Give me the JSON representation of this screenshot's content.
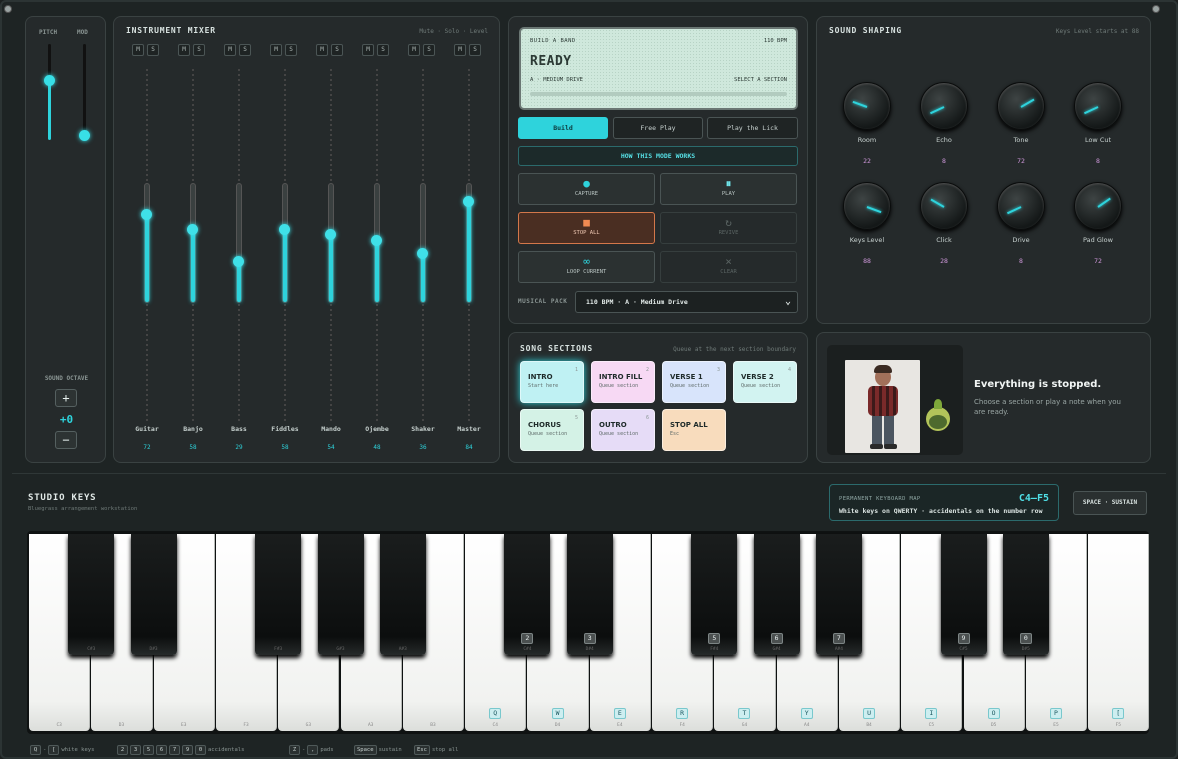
{
  "pitch_mod": {
    "pitch_label": "PITCH",
    "mod_label": "MOD",
    "pitch_level": 0.62,
    "mod_level": 0.05
  },
  "octave": {
    "label": "SOUND OCTAVE",
    "plus": "+",
    "value": "+0",
    "minus": "−"
  },
  "mixer": {
    "title": "INSTRUMENT MIXER",
    "subtitle": "Mute · Solo · Level",
    "mute_label": "M",
    "solo_label": "S",
    "channels": [
      {
        "name": "Guitar",
        "value": "72",
        "level": 72
      },
      {
        "name": "Banjo",
        "value": "58",
        "level": 58
      },
      {
        "name": "Bass",
        "value": "29",
        "level": 29
      },
      {
        "name": "Fiddles",
        "value": "58",
        "level": 58
      },
      {
        "name": "Mando",
        "value": "54",
        "level": 54
      },
      {
        "name": "Ojembe",
        "value": "48",
        "level": 48
      },
      {
        "name": "Shaker",
        "value": "36",
        "level": 36
      },
      {
        "name": "Master",
        "value": "84",
        "level": 84
      }
    ]
  },
  "display": {
    "mode_name": "BUILD A BAND",
    "bpm": "110 BPM",
    "status": "READY",
    "key": "A · MEDIUM DRIVE",
    "hint": "SELECT A SECTION"
  },
  "modes": {
    "build": "Build",
    "free_play": "Free Play",
    "play_lick": "Play the Lick"
  },
  "how_button": "HOW THIS MODE WORKS",
  "transport": {
    "capture": "CAPTURE",
    "play": "PLAY",
    "stop_all": "STOP ALL",
    "revive": "REVIVE",
    "loop_current": "LOOP CURRENT",
    "clear": "CLEAR"
  },
  "pack": {
    "label": "MUSICAL PACK",
    "value": "110 BPM · A · Medium Drive"
  },
  "shaping": {
    "title": "SOUND SHAPING",
    "subtitle": "Keys Level starts at 88",
    "knobs": [
      {
        "name": "Room",
        "value": "22",
        "angle": 200
      },
      {
        "name": "Echo",
        "value": "8",
        "angle": 155
      },
      {
        "name": "Tone",
        "value": "72",
        "angle": -30
      },
      {
        "name": "Low Cut",
        "value": "8",
        "angle": 155
      },
      {
        "name": "Keys Level",
        "value": "88",
        "angle": 20
      },
      {
        "name": "Click",
        "value": "28",
        "angle": 210
      },
      {
        "name": "Drive",
        "value": "8",
        "angle": 155
      },
      {
        "name": "Pad Glow",
        "value": "72",
        "angle": -35
      }
    ]
  },
  "sections": {
    "title": "SONG SECTIONS",
    "subtitle": "Queue at the next section boundary",
    "items": [
      {
        "name": "INTRO",
        "sub": "Start here",
        "key": "1",
        "color": "#bff1f3"
      },
      {
        "name": "INTRO FILL",
        "sub": "Queue section",
        "key": "2",
        "color": "#f7d9f4"
      },
      {
        "name": "VERSE 1",
        "sub": "Queue section",
        "key": "3",
        "color": "#d8e4fb"
      },
      {
        "name": "VERSE 2",
        "sub": "Queue section",
        "key": "4",
        "color": "#d2f3f1"
      },
      {
        "name": "CHORUS",
        "sub": "Queue section",
        "key": "5",
        "color": "#d4f2e6"
      },
      {
        "name": "OUTRO",
        "sub": "Queue section",
        "key": "6",
        "color": "#e6dcf7"
      },
      {
        "name": "STOP ALL",
        "sub": "Esc",
        "key": "",
        "color": "#f8dcbd"
      }
    ]
  },
  "status_card": {
    "title": "Everything is stopped.",
    "text": "Choose a section or play a note when you are ready."
  },
  "studio": {
    "title": "STUDIO KEYS",
    "subtitle": "Bluegrass arrangement workstation"
  },
  "keymap": {
    "label": "PERMANENT KEYBOARD MAP",
    "range": "C4–F5",
    "text": "White keys on QWERTY · accidentals on the number row"
  },
  "sustain": "SPACE · SUSTAIN",
  "keys": {
    "white": [
      {
        "note": "C3",
        "key": ""
      },
      {
        "note": "D3",
        "key": ""
      },
      {
        "note": "E3",
        "key": ""
      },
      {
        "note": "F3",
        "key": ""
      },
      {
        "note": "G3",
        "key": ""
      },
      {
        "note": "A3",
        "key": ""
      },
      {
        "note": "B3",
        "key": ""
      },
      {
        "note": "C4",
        "key": "Q"
      },
      {
        "note": "D4",
        "key": "W"
      },
      {
        "note": "E4",
        "key": "E"
      },
      {
        "note": "F4",
        "key": "R"
      },
      {
        "note": "G4",
        "key": "T"
      },
      {
        "note": "A4",
        "key": "Y"
      },
      {
        "note": "B4",
        "key": "U"
      },
      {
        "note": "C5",
        "key": "I"
      },
      {
        "note": "D5",
        "key": "O"
      },
      {
        "note": "E5",
        "key": "P"
      },
      {
        "note": "F5",
        "key": "["
      }
    ],
    "black": [
      {
        "note": "C#3",
        "key": ""
      },
      {
        "note": "D#3",
        "key": ""
      },
      {
        "note": "F#3",
        "key": ""
      },
      {
        "note": "G#3",
        "key": ""
      },
      {
        "note": "A#3",
        "key": ""
      },
      {
        "note": "C#4",
        "key": "2"
      },
      {
        "note": "D#4",
        "key": "3"
      },
      {
        "note": "F#4",
        "key": "5"
      },
      {
        "note": "G#4",
        "key": "6"
      },
      {
        "note": "A#4",
        "key": "7"
      },
      {
        "note": "C#5",
        "key": "9"
      },
      {
        "note": "D#5",
        "key": "0"
      }
    ]
  },
  "hints": {
    "white_from": "Q",
    "white_to": "[",
    "white_label": "white keys",
    "acc_keys": [
      "2",
      "3",
      "5",
      "6",
      "7",
      "9",
      "0"
    ],
    "acc_label": "accidentals",
    "pad_from": "Z",
    "pad_to": ",",
    "pad_label": "pads",
    "space": "Space",
    "space_label": "sustain",
    "esc": "Esc",
    "esc_label": "stop all"
  }
}
